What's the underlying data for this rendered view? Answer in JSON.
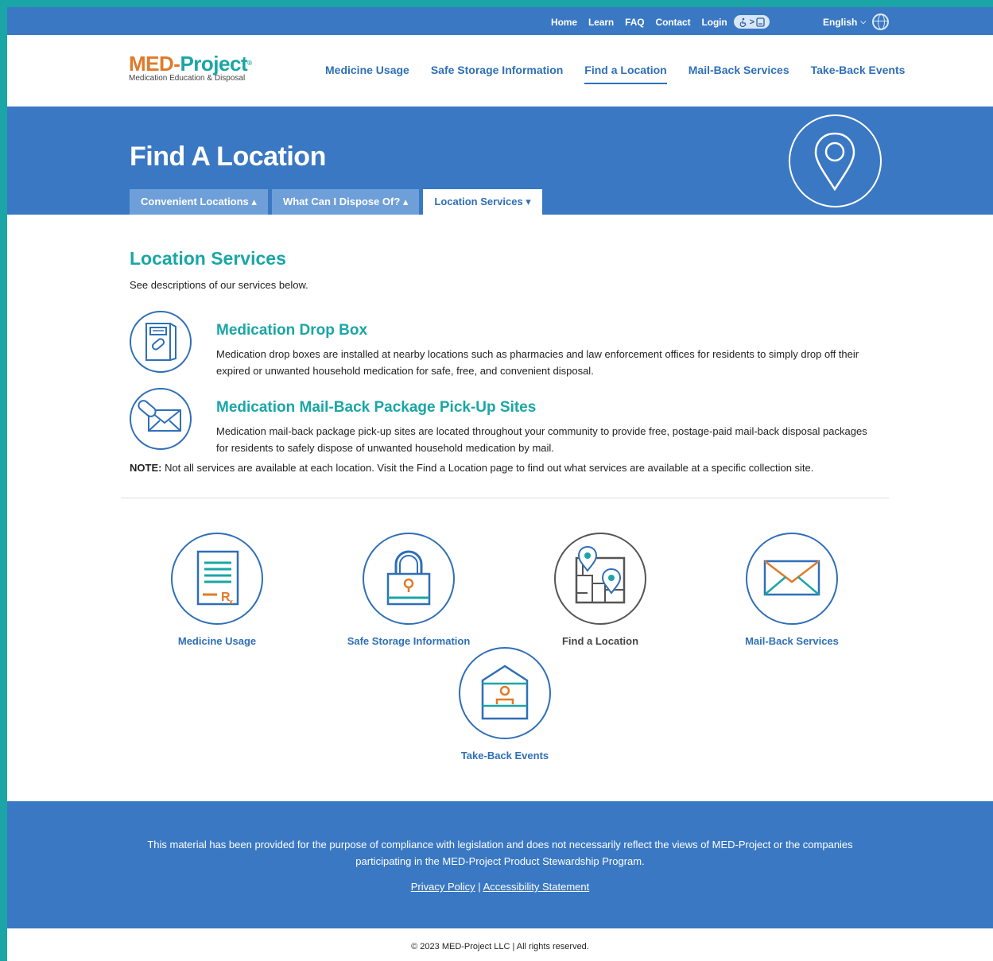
{
  "utility": {
    "links": [
      "Home",
      "Learn",
      "FAQ",
      "Contact",
      "Login"
    ],
    "accessibility_label": "&gt;",
    "language": "English"
  },
  "logo": {
    "med": "MED",
    "dash": "-",
    "project": "Project",
    "mark": "®",
    "tagline": "Medication Education & Disposal"
  },
  "nav": {
    "items": [
      "Medicine Usage",
      "Safe Storage Information",
      "Find a Location",
      "Mail-Back Services",
      "Take-Back Events"
    ],
    "active": "Find a Location"
  },
  "hero": {
    "title": "Find A Location",
    "tabs": [
      {
        "label": "Convenient Locations ▴",
        "active": false
      },
      {
        "label": "What Can I Dispose Of? ▴",
        "active": false
      },
      {
        "label": "Location Services ▾",
        "active": true
      }
    ]
  },
  "services": {
    "title": "Location Services",
    "subtitle": "See descriptions of our services below.",
    "items": [
      {
        "title": "Medication Drop Box",
        "text": "Medication drop boxes are installed at nearby locations such as pharmacies and law enforcement offices for residents to simply drop off their expired or unwanted household medication for safe, free, and convenient disposal.",
        "icon": "drop-box-icon"
      },
      {
        "title": "Medication Mail-Back Package Pick-Up Sites",
        "text": "Medication mail-back package pick-up sites are located throughout your community to provide free, postage-paid mail-back disposal packages for residents to safely dispose of unwanted household medication by mail.",
        "icon": "mail-pill-icon"
      }
    ],
    "note_label": "NOTE:",
    "note_text": " Not all services are available at each location. Visit the Find a Location page to find out what services are available at a specific collection site."
  },
  "tiles": [
    {
      "label": "Medicine Usage",
      "icon": "prescription-document-icon"
    },
    {
      "label": "Safe Storage Information",
      "icon": "padlock-icon"
    },
    {
      "label": "Find a Location",
      "icon": "map-pins-icon"
    },
    {
      "label": "Mail-Back Services",
      "icon": "envelope-icon"
    },
    {
      "label": "Take-Back Events",
      "icon": "kiosk-person-icon"
    }
  ],
  "footer": {
    "disclaimer": "This material has been provided for the purpose of compliance with legislation and does not necessarily reflect the views of MED-Project or the companies participating in the MED-Project Product Stewardship Program.",
    "privacy": "Privacy Policy",
    "separator": " | ",
    "accessibility": "Accessibility Statement",
    "copyright": "© 2023 MED-Project LLC | All rights reserved."
  },
  "colors": {
    "brand_blue": "#3a78c3",
    "link_blue": "#2f6fb8",
    "teal": "#1aa6a6",
    "orange": "#e07a2a"
  }
}
